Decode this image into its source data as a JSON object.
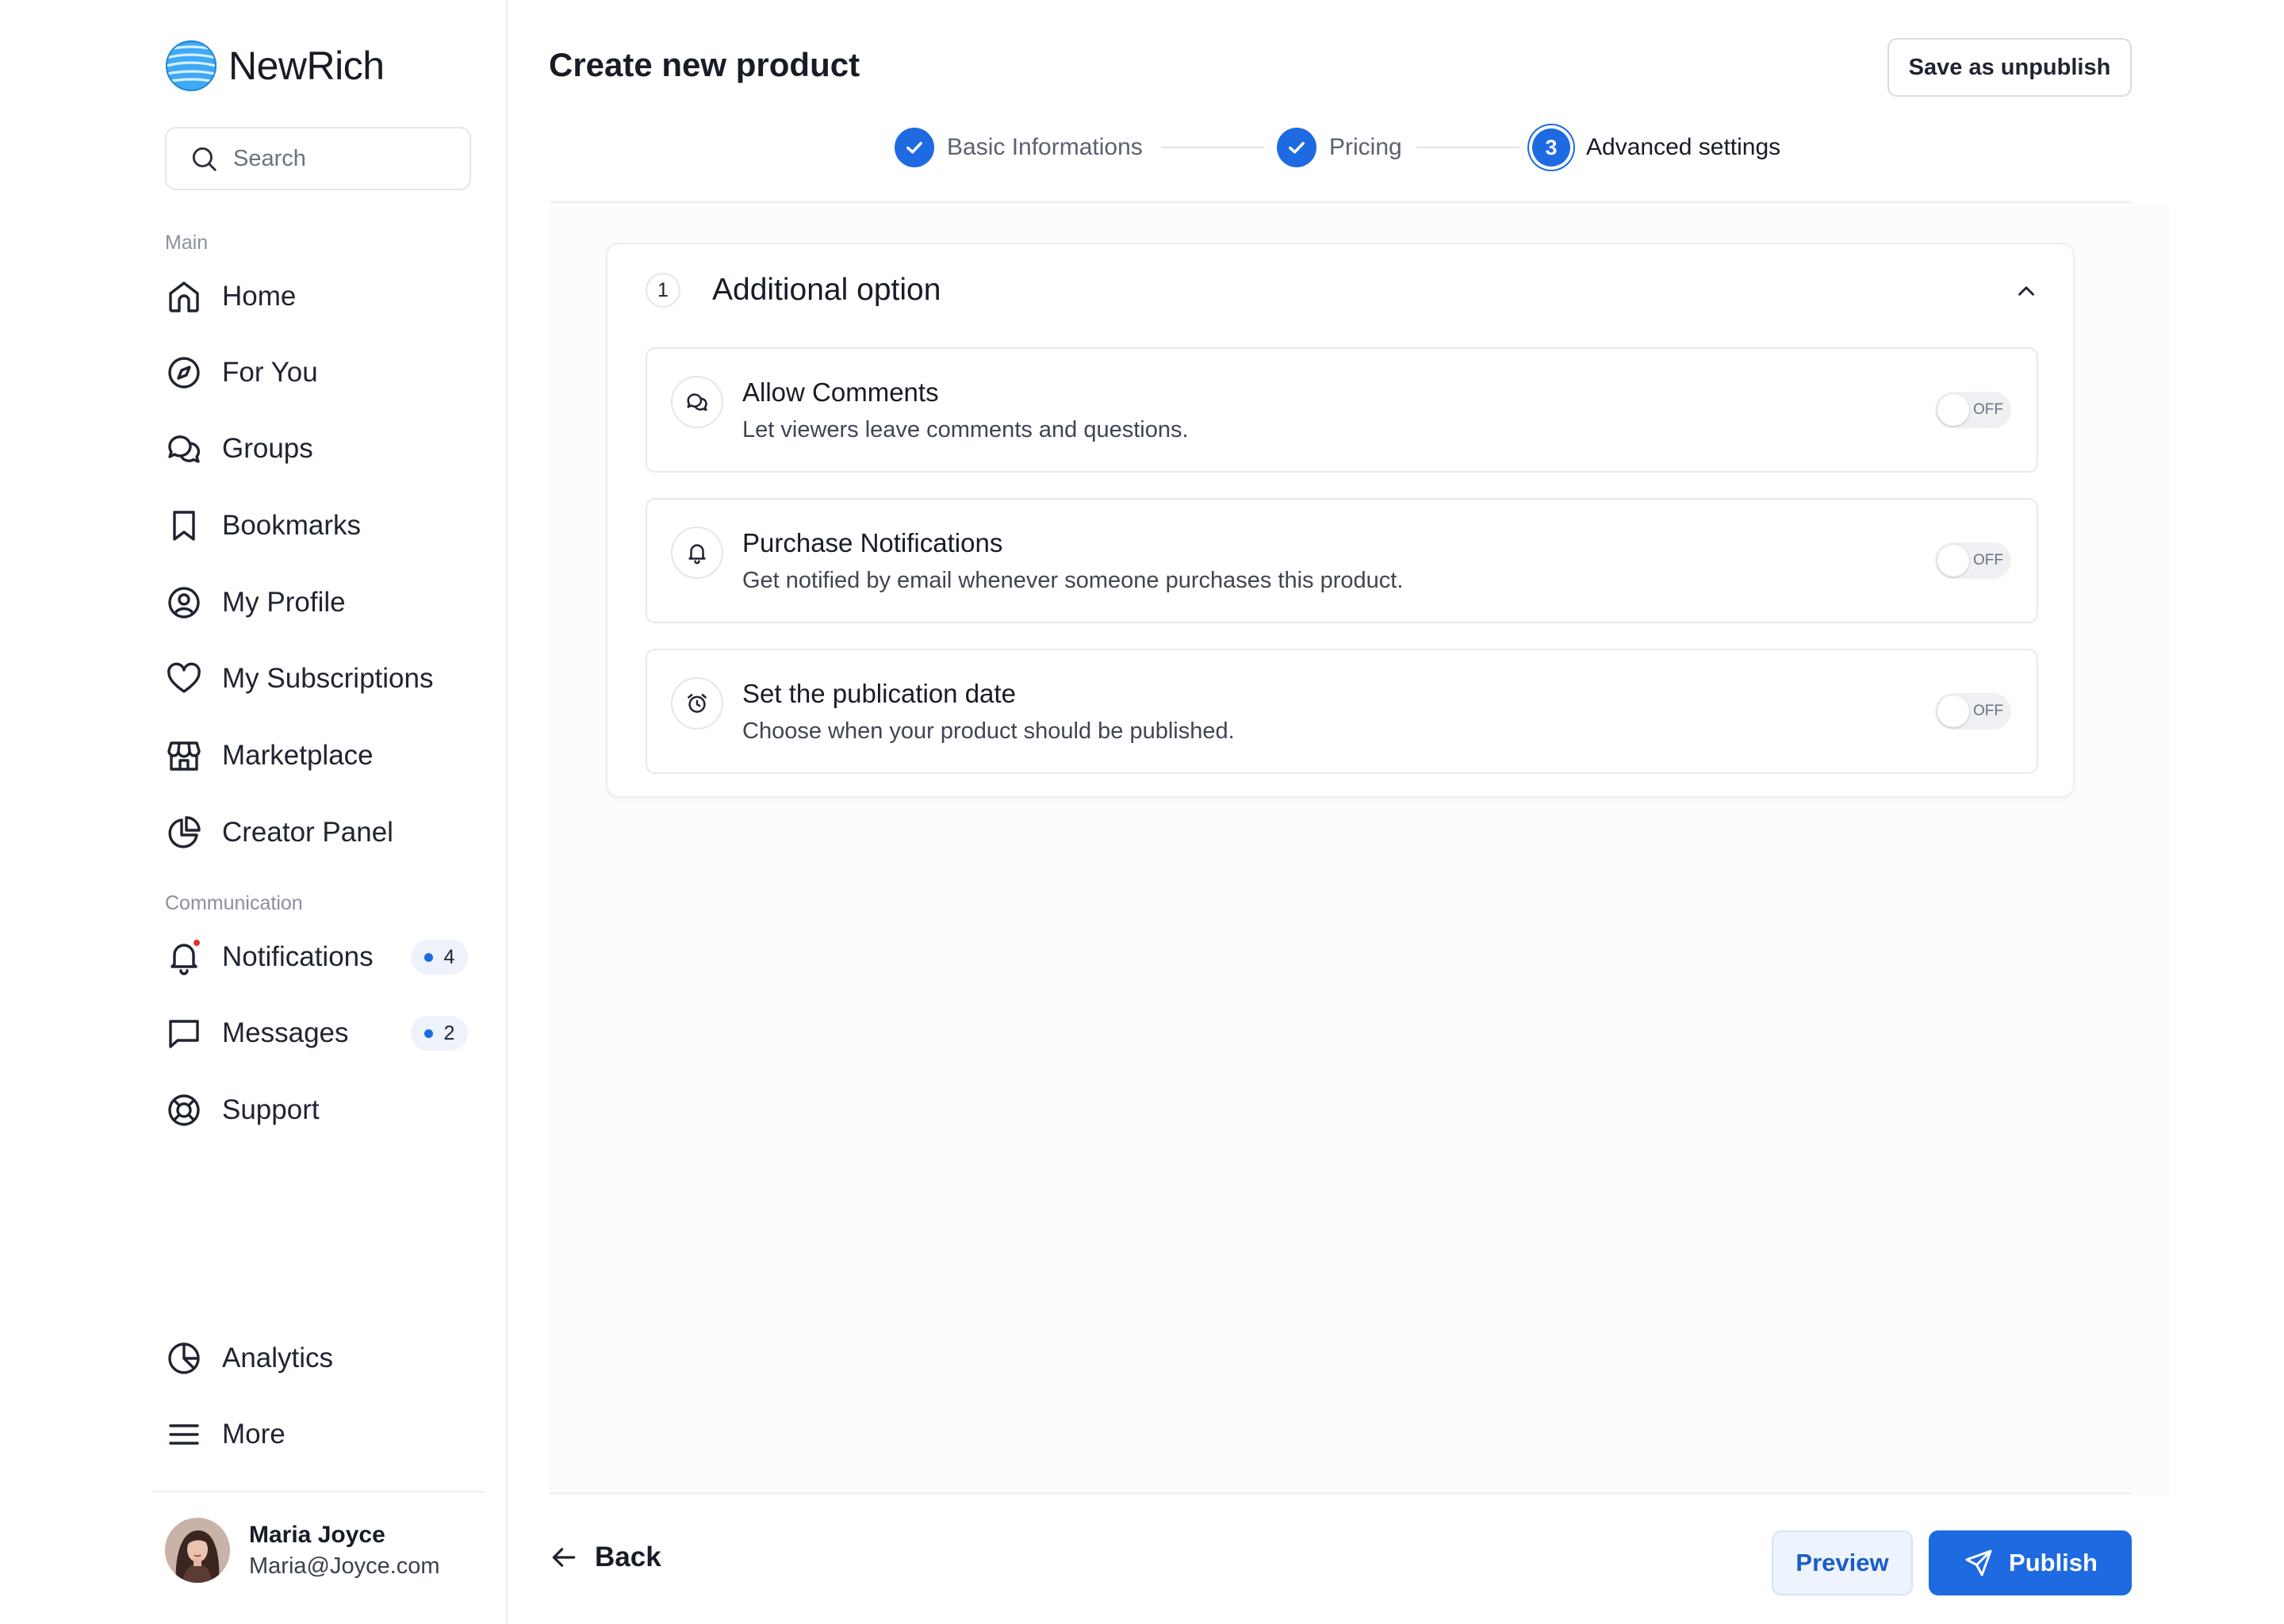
{
  "app": {
    "name": "NewRich"
  },
  "search": {
    "placeholder": "Search"
  },
  "sidebar": {
    "sections": {
      "main": "Main",
      "communication": "Communication"
    },
    "items": [
      {
        "label": "Home",
        "icon": "home-icon"
      },
      {
        "label": "For You",
        "icon": "compass-icon"
      },
      {
        "label": "Groups",
        "icon": "chat-bubbles-icon"
      },
      {
        "label": "Bookmarks",
        "icon": "bookmark-icon"
      },
      {
        "label": "My Profile",
        "icon": "user-circle-icon"
      },
      {
        "label": "My Subscriptions",
        "icon": "heart-icon"
      },
      {
        "label": "Marketplace",
        "icon": "storefront-icon"
      },
      {
        "label": "Creator Panel",
        "icon": "pie-chart-icon"
      }
    ],
    "comm_items": [
      {
        "label": "Notifications",
        "icon": "bell-icon",
        "badge": "4"
      },
      {
        "label": "Messages",
        "icon": "message-square-icon",
        "badge": "2"
      },
      {
        "label": "Support",
        "icon": "lifebuoy-icon"
      }
    ],
    "bottom_items": [
      {
        "label": "Analytics",
        "icon": "analytics-pie-icon"
      },
      {
        "label": "More",
        "icon": "menu-icon"
      }
    ],
    "user": {
      "name": "Maria Joyce",
      "email": "Maria@Joyce.com"
    }
  },
  "header": {
    "title": "Create new product",
    "save_label": "Save as unpublish"
  },
  "stepper": {
    "steps": [
      {
        "label": "Basic Informations",
        "state": "done"
      },
      {
        "label": "Pricing",
        "state": "done"
      },
      {
        "label": "Advanced settings",
        "state": "current",
        "number": "3"
      }
    ]
  },
  "panel": {
    "number": "1",
    "title": "Additional option",
    "options": [
      {
        "title": "Allow Comments",
        "description": "Let viewers leave comments and questions.",
        "toggle": "OFF",
        "icon": "comments-icon"
      },
      {
        "title": "Purchase Notifications",
        "description": "Get notified by email whenever someone purchases this product.",
        "toggle": "OFF",
        "icon": "bell-icon"
      },
      {
        "title": "Set the publication date",
        "description": "Choose when your product should be published.",
        "toggle": "OFF",
        "icon": "alarm-clock-icon"
      }
    ]
  },
  "footer": {
    "back_label": "Back",
    "preview_label": "Preview",
    "publish_label": "Publish"
  },
  "colors": {
    "accent": "#1e6ae1",
    "badge_dot": "#1e6ae1",
    "alert_dot": "#e0352b"
  }
}
